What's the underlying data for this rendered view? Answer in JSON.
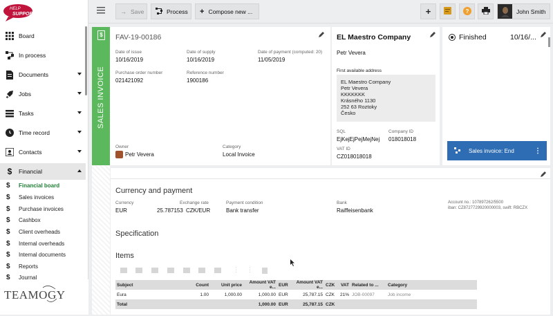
{
  "logo_text": "HELP SUPPORT",
  "sidebar": {
    "items": [
      {
        "label": "Board",
        "icon": "grid-icon"
      },
      {
        "label": "In process",
        "icon": "process-icon"
      },
      {
        "label": "Documents",
        "icon": "document-icon"
      },
      {
        "label": "Jobs",
        "icon": "rocket-icon"
      },
      {
        "label": "Tasks",
        "icon": "tasks-icon"
      },
      {
        "label": "Time record",
        "icon": "clock-icon"
      },
      {
        "label": "Contacts",
        "icon": "contact-icon"
      },
      {
        "label": "Financial",
        "icon": "dollar-icon"
      }
    ],
    "sub_items": [
      "Financial board",
      "Sales invoices",
      "Purchase invoices",
      "Cashbox",
      "Client overheads",
      "Internal overheads",
      "Internal documents",
      "Reports",
      "Journal"
    ],
    "brand": "TEAMOGY"
  },
  "toolbar": {
    "save_label": "Save",
    "process_label": "Process",
    "compose_label": "Compose new ...",
    "user_name": "John Smith"
  },
  "invoice": {
    "vertical_label": "SALES INVOICE",
    "number": "FAV-19-00186",
    "date_issue_label": "Date of issue",
    "date_issue": "10/16/2019",
    "date_supply_label": "Date of supply",
    "date_supply": "10/16/2019",
    "date_payment_label": "Date of payment (computed: 20)",
    "date_payment": "11/05/2019",
    "po_label": "Purchase order number",
    "po": "021421092",
    "ref_label": "Reference number",
    "ref": "1900186",
    "owner_label": "Owner",
    "owner": "Petr Vevera",
    "category_label": "Category",
    "category": "Local Invoice"
  },
  "company": {
    "name": "EL Maestro Company",
    "contact": "Petr Vevera",
    "address_label": "First available address",
    "address_lines": [
      "EL Maestro Company",
      "Petr Vevera",
      "KKKKKKK",
      "Krásného 1130",
      "252 63 Roztoky",
      "Česko"
    ],
    "sql_label": "SQL",
    "sql": "EjKejEjPejMejNej",
    "company_id_label": "Company ID",
    "company_id": "018018018",
    "vat_id_label": "VAT ID",
    "vat_id": "CZ018018018"
  },
  "status": {
    "label": "Finished",
    "date": "10/16/...",
    "flow_label": "Sales invoice: End"
  },
  "currency": {
    "title": "Currency and payment",
    "currency_label": "Currency",
    "currency": "EUR",
    "rate_label": "Exchange rate",
    "rate": "25.787153",
    "rate_unit": "CZK/EUR",
    "cond_label": "Payment condition",
    "cond": "Bank transfer",
    "bank_label": "Bank",
    "bank": "Raiffeisenbank",
    "account": "Account no.: 107897262/5500",
    "iban": "iban: CZ8727729920000003, swift: RBCZX"
  },
  "spec_title": "Specification",
  "items_title": "Items",
  "items_table": {
    "headers": [
      "Subject",
      "Count",
      "Unit price",
      "Amount VAT e...",
      "EUR",
      "Amount VAT e...",
      "CZK",
      "VAT",
      "Related to ...",
      "Category"
    ],
    "row": [
      "Eura",
      "1.00",
      "1,000.00",
      "1,000.00",
      "EUR",
      "25,787.15",
      "CZK",
      "21%",
      "JOB-00097",
      "Job income"
    ],
    "total": [
      "Total",
      "",
      "",
      "1,000.00",
      "EUR",
      "25,787.15",
      "CZK",
      "",
      "",
      ""
    ]
  }
}
